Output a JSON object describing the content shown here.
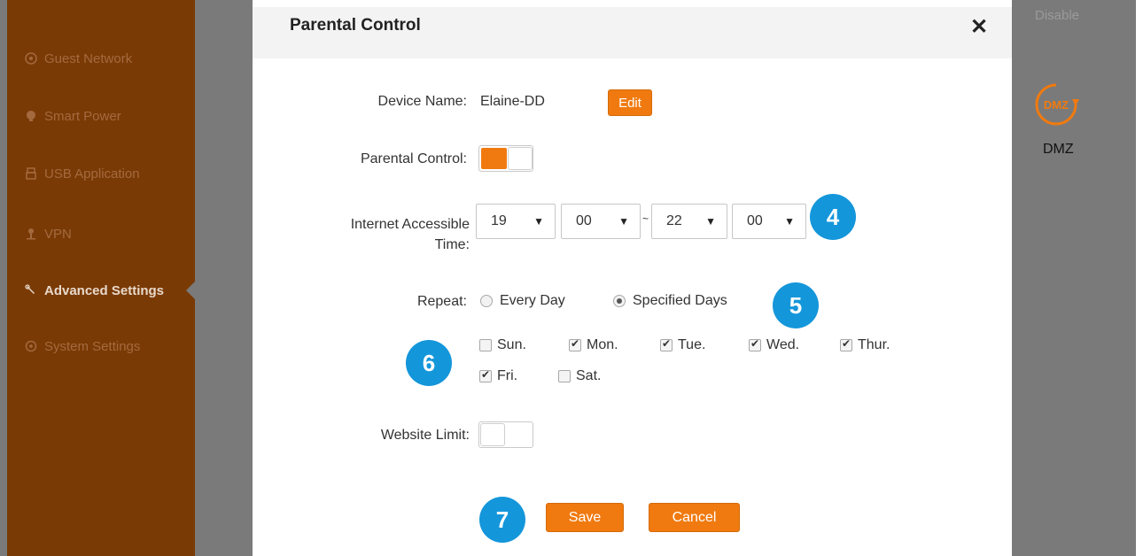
{
  "sidebar": {
    "items": [
      {
        "label": "Guest Network",
        "icon": "guest-network-icon"
      },
      {
        "label": "Smart Power",
        "icon": "smart-power-icon"
      },
      {
        "label": "USB Application",
        "icon": "usb-icon"
      },
      {
        "label": "VPN",
        "icon": "vpn-icon"
      },
      {
        "label": "Advanced Settings",
        "icon": "wrench-icon",
        "active": true
      },
      {
        "label": "System Settings",
        "icon": "gear-icon"
      }
    ]
  },
  "background": {
    "disable_label": "Disable",
    "dmz_icon_text": "DMZ",
    "dmz_label": "DMZ"
  },
  "modal": {
    "title": "Parental Control",
    "close_symbol": "✕",
    "device_name_label": "Device Name:",
    "device_name_value": "Elaine-DD",
    "edit_label": "Edit",
    "parental_control_label": "Parental Control:",
    "parental_control_on": true,
    "time_label_line1": "Internet Accessible",
    "time_label_line2": "Time:",
    "start_hour": "19",
    "start_minute": "00",
    "range_separator": "~",
    "end_hour": "22",
    "end_minute": "00",
    "repeat_label": "Repeat:",
    "repeat_options": [
      {
        "label": "Every Day",
        "checked": false
      },
      {
        "label": "Specified Days",
        "checked": true
      }
    ],
    "days": [
      {
        "label": "Sun.",
        "checked": false
      },
      {
        "label": "Mon.",
        "checked": true
      },
      {
        "label": "Tue.",
        "checked": true
      },
      {
        "label": "Wed.",
        "checked": true
      },
      {
        "label": "Thur.",
        "checked": true
      },
      {
        "label": "Fri.",
        "checked": true
      },
      {
        "label": "Sat.",
        "checked": false
      }
    ],
    "website_limit_label": "Website Limit:",
    "website_limit_on": false,
    "save_label": "Save",
    "cancel_label": "Cancel"
  },
  "callouts": [
    "4",
    "5",
    "6",
    "7"
  ],
  "colors": {
    "accent": "#f07a10",
    "sidebar_bg": "#7a3a05",
    "overlay_gray": "#7a7a7a",
    "callout_blue": "#1496da"
  }
}
